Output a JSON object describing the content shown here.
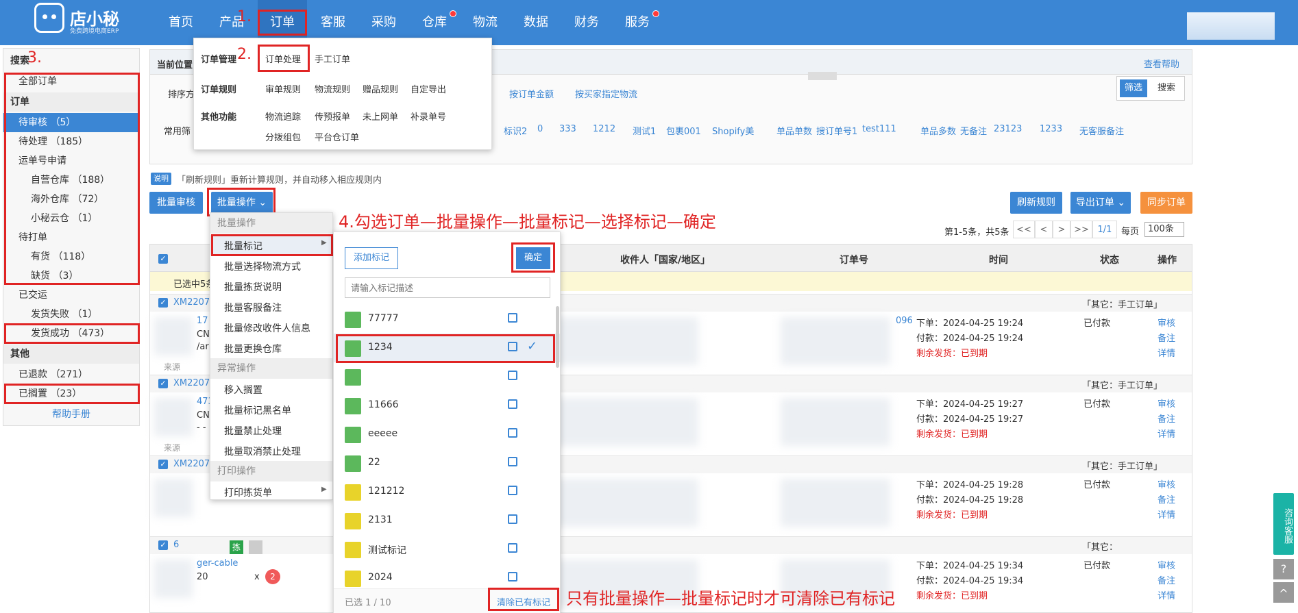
{
  "header": {
    "logo_name": "店小秘",
    "logo_sub": "免费跨境电商ERP",
    "nav": [
      "首页",
      "产品",
      "订单",
      "客服",
      "采购",
      "仓库",
      "物流",
      "数据",
      "财务",
      "服务"
    ]
  },
  "annotations": {
    "step1": "1.",
    "step2": "2.",
    "step3": "3.",
    "step4": "4.勾选订单—批量操作—批量标记—选择标记—确定",
    "note": "只有批量操作—批量标记时才可清除已有标记"
  },
  "order_menu": {
    "groups": [
      {
        "label": "订单管理",
        "items": [
          "订单处理",
          "手工订单"
        ]
      },
      {
        "label": "订单规则",
        "items": [
          "审单规则",
          "物流规则",
          "赠品规则",
          "自定导出"
        ]
      },
      {
        "label": "其他功能",
        "items": [
          "物流追踪",
          "传预报单",
          "未上网单",
          "补录单号",
          "分拨组包",
          "平台仓订单"
        ]
      }
    ]
  },
  "sidebar": {
    "search_header": "搜索",
    "all_orders": "全部订单",
    "orders_header": "订单",
    "items": [
      {
        "label": "待审核 （5）"
      },
      {
        "label": "待处理 （185）"
      },
      {
        "label": "运单号申请"
      },
      {
        "label": "自营仓库 （188）"
      },
      {
        "label": "海外仓库 （72）"
      },
      {
        "label": "小秘云仓 （1）"
      },
      {
        "label": "待打单"
      },
      {
        "label": "有货 （118）"
      },
      {
        "label": "缺货 （3）"
      },
      {
        "label": "已交运"
      },
      {
        "label": "发货失败 （1）"
      },
      {
        "label": "发货成功 （473）"
      }
    ],
    "other_header": "其他",
    "refunded": "已退款 （271）",
    "shelved": "已搁置 （23）",
    "help": "帮助手册"
  },
  "filter": {
    "position_label": "当前位置",
    "help_link": "查看帮助",
    "sort_label": "排序方",
    "sort_options": [
      "按订单金额",
      "按买家指定物流"
    ],
    "toggle": [
      "筛选",
      "搜索"
    ],
    "common_label": "常用筛",
    "common_tags": [
      "标识2",
      "0",
      "333",
      "1212",
      "测试1",
      "包裹001",
      "Shopify美",
      "单品单数",
      "搜订单号1",
      "test111",
      "单品多数",
      "无备注",
      "23123",
      "1233",
      "无客服备注"
    ]
  },
  "info": {
    "badge": "说明",
    "text": "「刷新规则」重新计算规则，并自动移入相应规则内"
  },
  "toolbar": {
    "batch_audit": "批量审核",
    "batch_ops": "批量操作 ⌄",
    "refresh_rules": "刷新规则",
    "export_orders": "导出订单 ⌄",
    "sync_orders": "同步订单",
    "pagination_text": "第1-5条，共5条",
    "pager": [
      "<<",
      "<",
      ">",
      ">>"
    ],
    "page": "1/1",
    "per_page_label": "每页",
    "per_page_value": "100条"
  },
  "batch_menu": {
    "group1": "批量操作",
    "items1": [
      "批量标记",
      "批量选择物流方式",
      "批量拣货说明",
      "批量客服备注",
      "批量修改收件人信息",
      "批量更换仓库"
    ],
    "group2": "异常操作",
    "items2": [
      "移入搁置",
      "批量标记黑名单",
      "批量禁止处理",
      "批量取消禁止处理"
    ],
    "group3": "打印操作",
    "items3": [
      "打印拣货单"
    ]
  },
  "tag_panel": {
    "add_button": "添加标记",
    "confirm_button": "确定",
    "search_placeholder": "请输入标记描述",
    "tags": [
      {
        "name": "77777",
        "color": "#5cb85c"
      },
      {
        "name": "1234",
        "color": "#5cb85c"
      },
      {
        "name": "",
        "color": "#5cb85c"
      },
      {
        "name": "11666",
        "color": "#5cb85c"
      },
      {
        "name": "eeeee",
        "color": "#5cb85c"
      },
      {
        "name": "22",
        "color": "#5cb85c"
      },
      {
        "name": "121212",
        "color": "#e8d32a"
      },
      {
        "name": "2131",
        "color": "#e8d32a"
      },
      {
        "name": "测试标记",
        "color": "#e8d32a"
      },
      {
        "name": "2024",
        "color": "#e8d32a"
      }
    ],
    "selected_count": "已选 1 / 10",
    "clear_link": "清除已有标记"
  },
  "table": {
    "headers": [
      "收件人「国家/地区」",
      "订单号",
      "时间",
      "状态",
      "操作"
    ],
    "selected_bar": "已选中5条",
    "orders": [
      {
        "id": "XM22070",
        "store": "「其它：手工订单」",
        "snippet": [
          "17",
          "CNY",
          "/ari"
        ],
        "order_tail": "096",
        "time1": "下单：2024-04-25 19:24",
        "time2": "付款：2024-04-25 19:24",
        "remain": "剩余发货：已到期",
        "status": "已付款",
        "actions": [
          "审核",
          "备注",
          "详情"
        ],
        "source": "来源"
      },
      {
        "id": "XM22070",
        "store": "「其它：手工订单」",
        "snippet": [
          "473",
          "CNY",
          "- -"
        ],
        "order_tail": "",
        "time1": "下单：2024-04-25 19:27",
        "time2": "付款：2024-04-25 19:27",
        "remain": "剩余发货：已到期",
        "status": "已付款",
        "actions": [
          "审核",
          "备注",
          "详情"
        ],
        "source": "来源"
      },
      {
        "id": "XM22070",
        "store": "「其它：手工订单」",
        "snippet": [
          "",
          "",
          ""
        ],
        "order_tail": "",
        "time1": "下单：2024-04-25 19:28",
        "time2": "付款：2024-04-25 19:28",
        "remain": "剩余发货：已到期",
        "status": "已付款",
        "actions": [
          "审核",
          "备注",
          "详情"
        ],
        "source": ""
      },
      {
        "id": "6",
        "store": "「其它：",
        "snippet": [
          "ger-cable",
          "20",
          ""
        ],
        "order_tail": "",
        "time1": "下单：2024-04-25 19:34",
        "time2": "付款：2024-04-25 19:34",
        "remain": "剩余发货：已到期",
        "status": "已付款",
        "actions": [
          "审核",
          "备注",
          "详情"
        ],
        "source": "",
        "badge": "拣",
        "qty": "x",
        "count": "2"
      }
    ]
  },
  "float": {
    "consult": "咨询客服",
    "help": "?",
    "top": "^"
  }
}
